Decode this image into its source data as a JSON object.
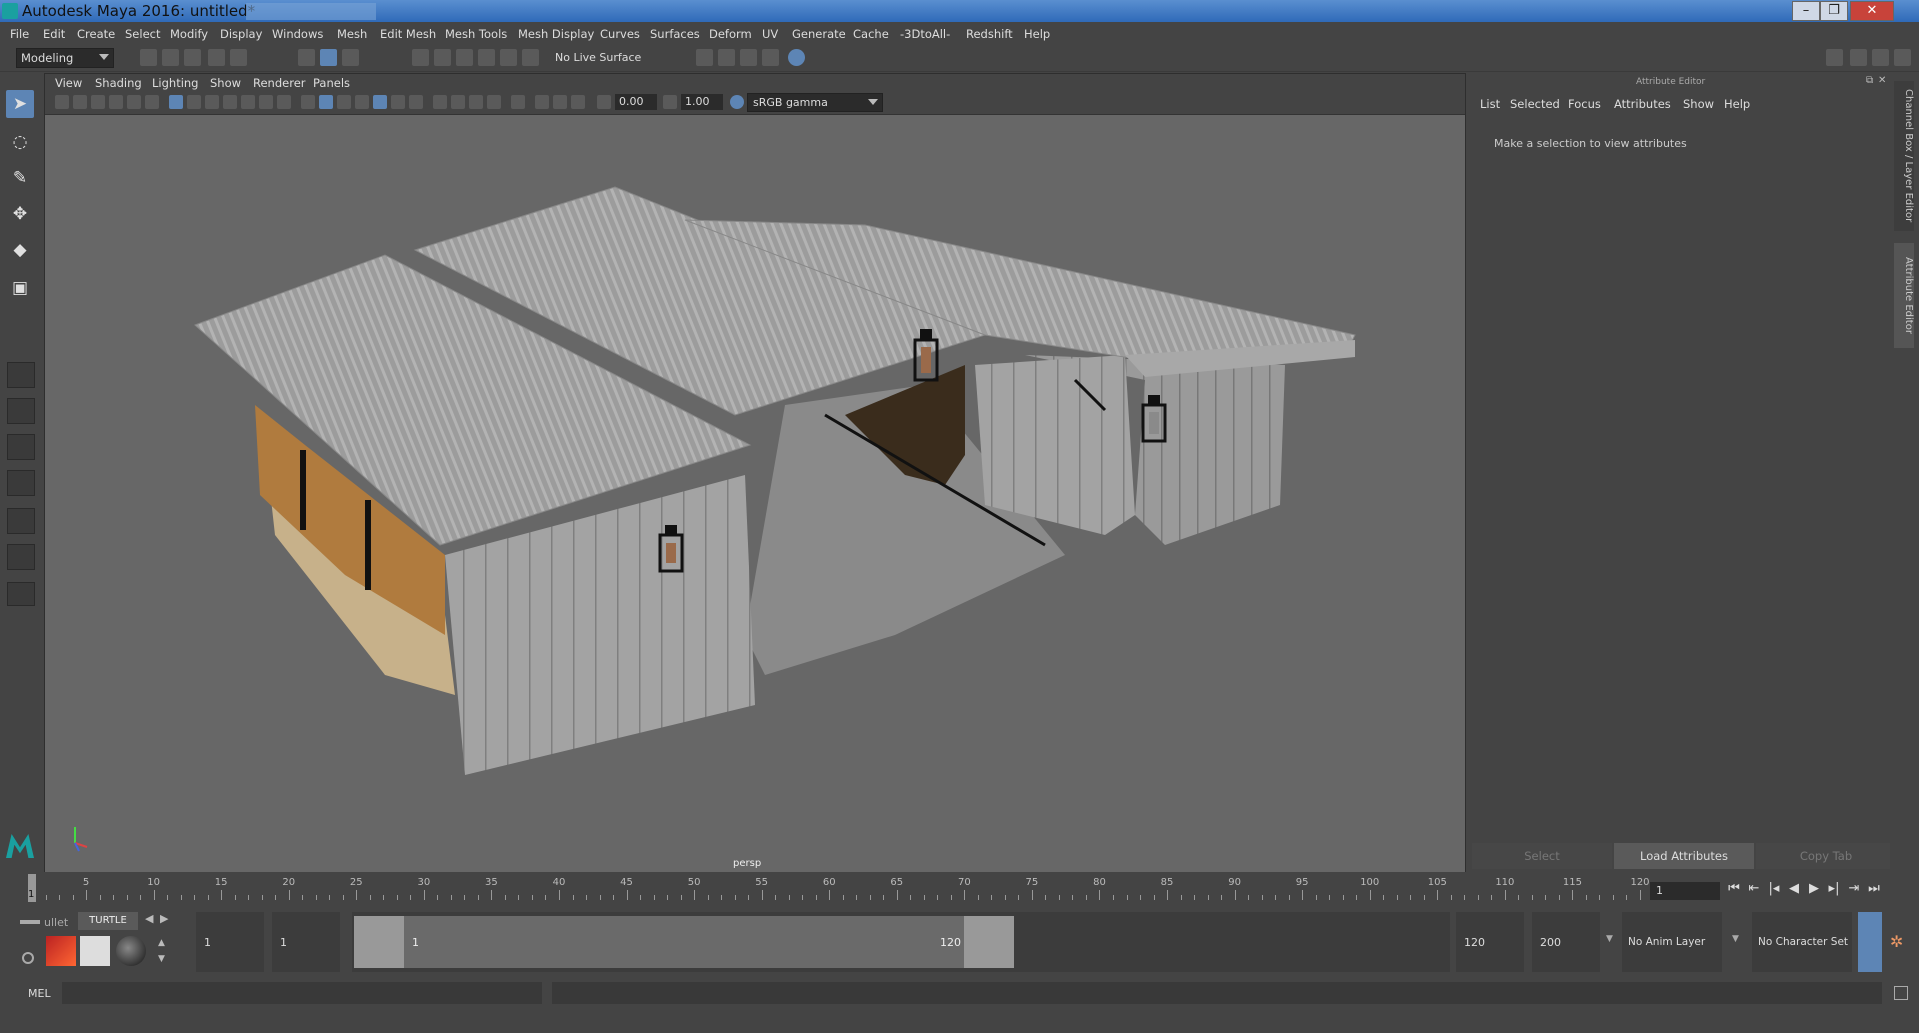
{
  "window": {
    "title": "Autodesk Maya 2016: untitled*",
    "min": "–",
    "max": "❐",
    "close": "✕"
  },
  "menubar": [
    "File",
    "Edit",
    "Create",
    "Select",
    "Modify",
    "Display",
    "Windows",
    "Mesh",
    "Edit Mesh",
    "Mesh Tools",
    "Mesh Display",
    "Curves",
    "Surfaces",
    "Deform",
    "UV",
    "Generate",
    "Cache",
    "-3DtoAll-",
    "Redshift",
    "Help"
  ],
  "statusline": {
    "mode": "Modeling",
    "live_surface": "No Live Surface"
  },
  "viewport": {
    "menus": [
      "View",
      "Shading",
      "Lighting",
      "Show",
      "Renderer",
      "Panels"
    ],
    "exposure": "0.00",
    "gamma": "1.00",
    "color_space": "sRGB gamma",
    "camera_label": "persp"
  },
  "attribute_editor": {
    "header": "Attribute Editor",
    "menus": [
      "List",
      "Selected",
      "Focus",
      "Attributes",
      "Show",
      "Help"
    ],
    "message": "Make a selection to view attributes",
    "buttons": {
      "select": "Select",
      "load": "Load Attributes",
      "copy": "Copy Tab"
    },
    "side_tabs": [
      "Channel Box / Layer Editor",
      "Attribute Editor"
    ]
  },
  "timeline": {
    "ticks": [
      "5",
      "10",
      "15",
      "20",
      "25",
      "30",
      "35",
      "40",
      "45",
      "50",
      "55",
      "60",
      "65",
      "70",
      "75",
      "80",
      "85",
      "90",
      "95",
      "100",
      "105",
      "110",
      "115",
      "120"
    ],
    "current_frame_marker": "1",
    "current_frame": "1"
  },
  "range": {
    "shelf_tab_partial": "ullet",
    "shelf_tab": "TURTLE",
    "start_time": "1",
    "playback_start": "1",
    "range_start_label": "1",
    "range_end_label": "120",
    "playback_end": "120",
    "end_time": "200",
    "anim_layer": "No Anim Layer",
    "character_set": "No Character Set"
  },
  "command_line": {
    "label": "MEL"
  },
  "colors": {
    "accent": "#5d85b5",
    "viewport_bg": "#676767",
    "panel_bg": "#444444"
  }
}
